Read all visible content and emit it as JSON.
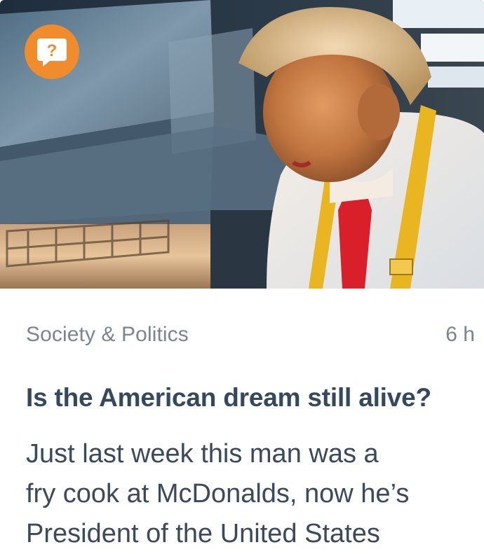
{
  "card": {
    "category": "Society & Politics",
    "time_ago": "6 h",
    "headline": "Is the American dream still alive?",
    "summary_lines": [
      "Just last week this man was a",
      "fry cook at McDonalds, now he’s",
      "President of the United States"
    ],
    "badge_icon": "question-speech-bubble-icon",
    "badge_color": "#f08c2c"
  }
}
